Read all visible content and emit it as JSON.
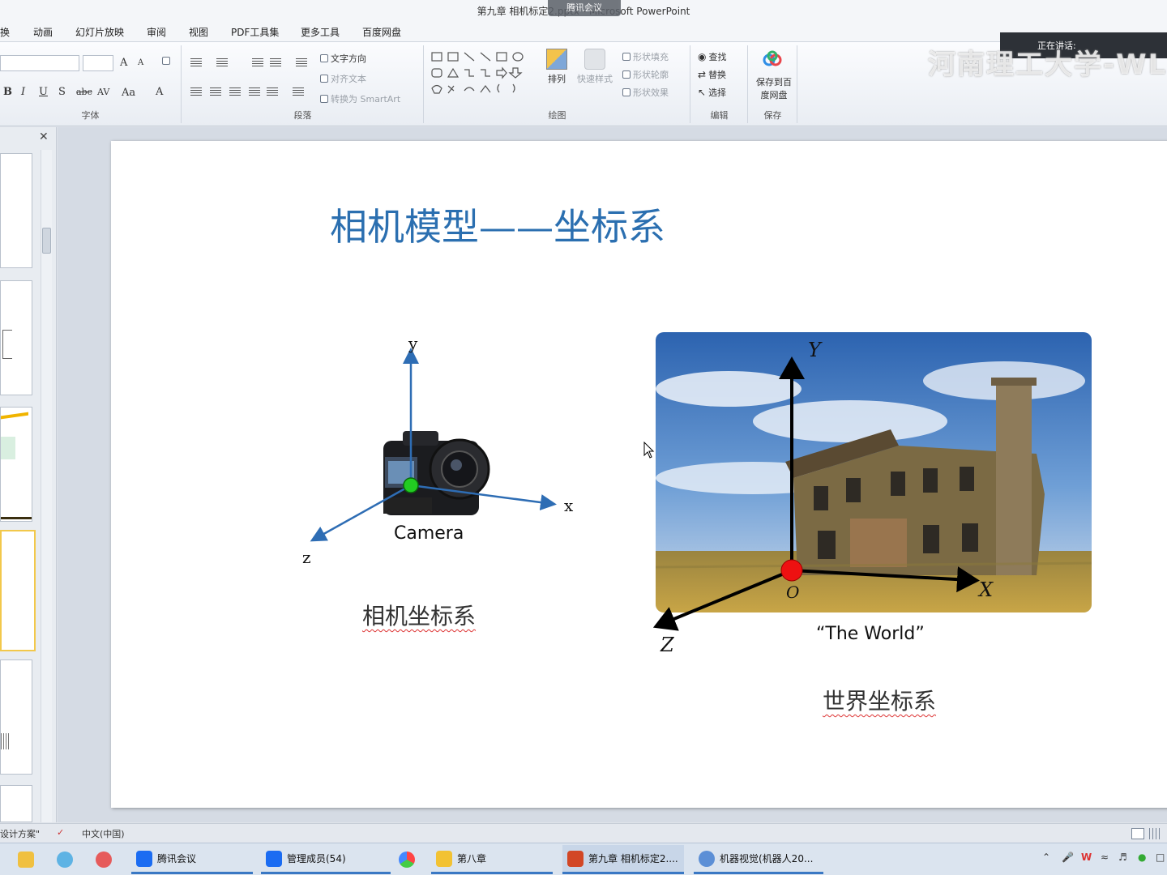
{
  "window": {
    "title": "第九章 相机标定2.pptx - Microsoft PowerPoint",
    "meeting_overlay": "腾讯会议",
    "now_speaking": "正在讲话:",
    "watermark": "河南理工大学-WL"
  },
  "menu": {
    "tabs": [
      "换",
      "动画",
      "幻灯片放映",
      "审阅",
      "视图",
      "PDF工具集",
      "更多工具",
      "百度网盘"
    ]
  },
  "ribbon": {
    "font_group": {
      "label": "字体",
      "grow": "A",
      "shrink": "A",
      "bold": "B",
      "italic": "I",
      "underline": "U",
      "shadow": "S",
      "strike": "abc",
      "spacing": "AV",
      "case": "Aa",
      "color": "A"
    },
    "paragraph_group": {
      "label": "段落",
      "text_direction": "文字方向",
      "align_text": "对齐文本",
      "smartart": "转换为 SmartArt"
    },
    "drawing_group": {
      "label": "绘图",
      "arrange": "排列",
      "quick_styles": "快速样式",
      "shape_fill": "形状填充",
      "shape_outline": "形状轮廓",
      "shape_effects": "形状效果"
    },
    "editing_group": {
      "label": "编辑",
      "find": "查找",
      "replace": "替换",
      "select": "选择"
    },
    "save_group": {
      "label": "保存",
      "save_baidu": "保存到百度网盘"
    }
  },
  "slide": {
    "title": "相机模型——坐标系",
    "camera_axes": {
      "y": "y",
      "x": "x",
      "z": "z"
    },
    "camera_caption": "Camera",
    "camera_cs_label": "相机坐标系",
    "world_axes": {
      "y": "Y",
      "x": "X",
      "z": "Z",
      "origin": "O"
    },
    "world_caption": "“The World”",
    "world_cs_label": "世界坐标系"
  },
  "statusbar": {
    "theme": "设计方案\"",
    "language": "中文(中国)"
  },
  "taskbar": {
    "items": [
      {
        "label": "腾讯会议"
      },
      {
        "label": "管理成员(54)"
      },
      {
        "label": "第八章"
      },
      {
        "label": "第九章 相机标定2...."
      },
      {
        "label": "机器视觉(机器人20..."
      }
    ]
  },
  "colors": {
    "title_blue": "#2b6fb0",
    "axis_blue": "#2e6db4",
    "origin_green": "#22cc22",
    "origin_red": "#ee1111"
  }
}
